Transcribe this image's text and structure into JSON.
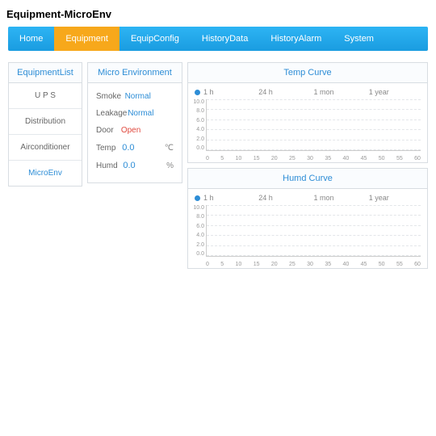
{
  "page_title": "Equipment-MicroEnv",
  "nav": {
    "items": [
      {
        "label": "Home"
      },
      {
        "label": "Equipment",
        "active": true
      },
      {
        "label": "EquipConfig"
      },
      {
        "label": "HistoryData"
      },
      {
        "label": "HistoryAlarm"
      },
      {
        "label": "System"
      }
    ]
  },
  "sidebar": {
    "header": "EquipmentList",
    "items": [
      {
        "label": "U P S"
      },
      {
        "label": "Distribution"
      },
      {
        "label": "Airconditioner"
      },
      {
        "label": "MicroEnv",
        "active": true
      }
    ]
  },
  "env": {
    "header": "Micro Environment",
    "rows": {
      "smoke": {
        "label": "Smoke",
        "value": "Normal",
        "cls": "v-normal",
        "unit": ""
      },
      "leak": {
        "label": "Leakage",
        "value": "Normal",
        "cls": "v-normal",
        "unit": ""
      },
      "door": {
        "label": "Door",
        "value": "Open",
        "cls": "v-open",
        "unit": ""
      },
      "temp": {
        "label": "Temp",
        "value": "0.0",
        "cls": "v-num",
        "unit": "℃"
      },
      "humd": {
        "label": "Humd",
        "value": "0.0",
        "cls": "v-num",
        "unit": "%"
      }
    }
  },
  "charts": {
    "ranges": [
      "1 h",
      "24 h",
      "1 mon",
      "1 year"
    ],
    "y_ticks": [
      "10.0",
      "8.0",
      "6.0",
      "4.0",
      "2.0",
      "0.0"
    ],
    "x_ticks": [
      "0",
      "5",
      "10",
      "15",
      "20",
      "25",
      "30",
      "35",
      "40",
      "45",
      "50",
      "55",
      "60"
    ],
    "temp": {
      "header": "Temp Curve"
    },
    "humd": {
      "header": "Humd Curve"
    }
  },
  "chart_data": [
    {
      "type": "line",
      "title": "Temp Curve",
      "xlabel": "",
      "ylabel": "",
      "xlim": [
        0,
        60
      ],
      "ylim": [
        0,
        10
      ],
      "series": [
        {
          "name": "1 h",
          "x": [],
          "y": []
        }
      ]
    },
    {
      "type": "line",
      "title": "Humd Curve",
      "xlabel": "",
      "ylabel": "",
      "xlim": [
        0,
        60
      ],
      "ylim": [
        0,
        10
      ],
      "series": [
        {
          "name": "1 h",
          "x": [],
          "y": []
        }
      ]
    }
  ]
}
